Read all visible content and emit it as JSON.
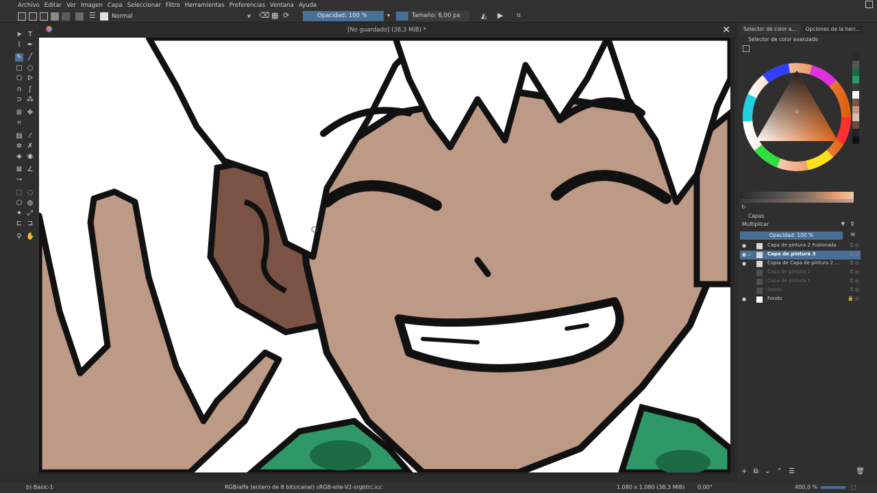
{
  "menu": [
    "Archivo",
    "Editar",
    "Ver",
    "Imagen",
    "Capa",
    "Seleccionar",
    "Filtro",
    "Herramientas",
    "Preferencias",
    "Ventana",
    "Ayuda"
  ],
  "toolbar": {
    "blend_mode": "Normal",
    "opacity_label": "Opacidad: 100 %",
    "size_label": "Tamaño: 6,00 px"
  },
  "document": {
    "title": "[No guardado]  (38,3 MiB) *"
  },
  "docker": {
    "tabs": [
      "Selector de color a...",
      "Opciones de la herr..."
    ],
    "advanced_title": "Selector de color avanzado",
    "layers_title": "Capas",
    "layer_blend": "Multiplicar",
    "layer_opacity": "Opacidad:  100 %",
    "layers": [
      {
        "name": "Capa de pintura 2 Fusionada",
        "visible": true,
        "selected": false,
        "dim": false
      },
      {
        "name": "Capa de pintura 3",
        "visible": true,
        "selected": true,
        "dim": false
      },
      {
        "name": "Copia de Capa de pintura 2 ...",
        "visible": true,
        "selected": false,
        "dim": false
      },
      {
        "name": "Capa de pintura 2",
        "visible": false,
        "selected": false,
        "dim": true
      },
      {
        "name": "Capa de pintura 1",
        "visible": false,
        "selected": false,
        "dim": true
      },
      {
        "name": "Fondo",
        "visible": false,
        "selected": false,
        "dim": true
      },
      {
        "name": "Fondo",
        "visible": true,
        "selected": false,
        "dim": false
      }
    ]
  },
  "status": {
    "brush": "b) Basic-1",
    "color_space": "RGB/alfa (entero de 8 bits/canal)  sRGB-elle-V2-srgbtrc.icc",
    "dimensions": "1.080 x 1.080 (38,3 MiB)",
    "rotation": "0,00°",
    "zoom": "400,0 %"
  },
  "colors": {
    "accent": "#4a6f95",
    "skin": "#bd9a85",
    "skin_shadow": "#7a5344",
    "jacket": "#2e9966",
    "jacket_dark": "#1c6b45"
  }
}
